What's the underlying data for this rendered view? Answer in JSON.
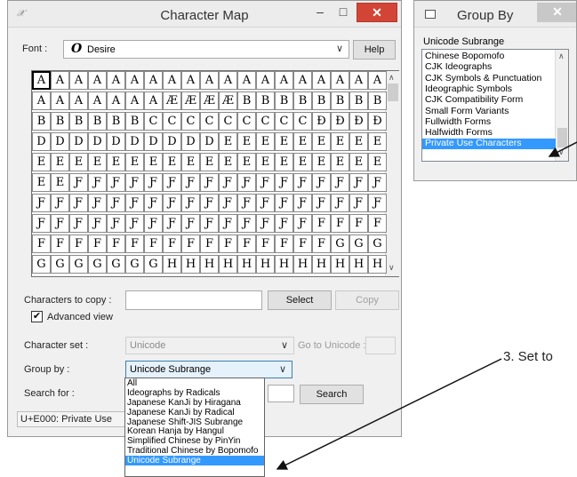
{
  "char_map": {
    "title": "Character Map",
    "font_label": "Font :",
    "font_value": "Desire",
    "font_glyph": "O",
    "help_label": "Help",
    "grid_rows": [
      [
        "A",
        "A",
        "A",
        "A",
        "A",
        "A",
        "A",
        "A",
        "A",
        "A",
        "A",
        "A",
        "A",
        "A",
        "A",
        "A",
        "A",
        "A",
        "A"
      ],
      [
        "A",
        "A",
        "A",
        "A",
        "A",
        "A",
        "A",
        "Æ",
        "Æ",
        "Æ",
        "Æ",
        "B",
        "B",
        "B",
        "B",
        "B",
        "B",
        "B",
        "B"
      ],
      [
        "B",
        "B",
        "B",
        "B",
        "B",
        "B",
        "C",
        "C",
        "C",
        "C",
        "C",
        "C",
        "C",
        "C",
        "C",
        "Ð",
        "Ð",
        "Ð",
        "Ð"
      ],
      [
        "D",
        "D",
        "D",
        "D",
        "D",
        "D",
        "D",
        "D",
        "D",
        "D",
        "E",
        "E",
        "E",
        "E",
        "E",
        "E",
        "E",
        "E",
        "E"
      ],
      [
        "E",
        "E",
        "E",
        "E",
        "E",
        "E",
        "E",
        "E",
        "E",
        "E",
        "E",
        "E",
        "E",
        "E",
        "E",
        "E",
        "E",
        "E",
        "E"
      ],
      [
        "E",
        "E",
        "Ƒ",
        "Ƒ",
        "Ƒ",
        "Ƒ",
        "Ƒ",
        "Ƒ",
        "Ƒ",
        "Ƒ",
        "Ƒ",
        "Ƒ",
        "Ƒ",
        "Ƒ",
        "Ƒ",
        "Ƒ",
        "Ƒ",
        "Ƒ",
        "Ƒ"
      ],
      [
        "Ƒ",
        "Ƒ",
        "Ƒ",
        "Ƒ",
        "Ƒ",
        "Ƒ",
        "Ƒ",
        "Ƒ",
        "Ƒ",
        "Ƒ",
        "Ƒ",
        "Ƒ",
        "Ƒ",
        "Ƒ",
        "Ƒ",
        "Ƒ",
        "Ƒ",
        "Ƒ",
        "Ƒ"
      ],
      [
        "Ƒ",
        "Ƒ",
        "Ƒ",
        "Ƒ",
        "Ƒ",
        "Ƒ",
        "Ƒ",
        "Ƒ",
        "Ƒ",
        "Ƒ",
        "Ƒ",
        "Ƒ",
        "Ƒ",
        "Ƒ",
        "Ƒ",
        "F",
        "F",
        "F",
        "F"
      ],
      [
        "F",
        "F",
        "F",
        "F",
        "F",
        "F",
        "F",
        "F",
        "F",
        "F",
        "F",
        "F",
        "F",
        "F",
        "F",
        "F",
        "G",
        "G",
        "G"
      ],
      [
        "G",
        "G",
        "G",
        "G",
        "G",
        "G",
        "G",
        "H",
        "H",
        "H",
        "H",
        "H",
        "H",
        "H",
        "H",
        "H",
        "H",
        "H",
        "H"
      ]
    ],
    "chars_to_copy_label": "Characters to copy :",
    "chars_to_copy_value": "",
    "select_label": "Select",
    "copy_label": "Copy",
    "advanced_view_label": "Advanced view",
    "advanced_view_checked": "✔",
    "character_set_label": "Character set :",
    "character_set_value": "Unicode",
    "go_to_unicode_label": "Go to Unicode :",
    "group_by_label": "Group by :",
    "group_by_value": "Unicode Subrange",
    "group_by_options": [
      "All",
      "Ideographs by Radicals",
      "Japanese KanJi by Hiragana",
      "Japanese KanJi by Radical",
      "Japanese Shift-JIS Subrange",
      "Korean Hanja by Hangul",
      "Simplified Chinese by PinYin",
      "Traditional Chinese by Bopomofo",
      "Unicode Subrange"
    ],
    "search_for_label": "Search for :",
    "search_label": "Search",
    "status_text": "U+E000: Private Use"
  },
  "group_by_window": {
    "title": "Group By",
    "heading": "Unicode Subrange",
    "items": [
      "Chinese Bopomofo",
      "CJK Ideographs",
      "CJK Symbols & Punctuation",
      "Ideographic Symbols",
      "CJK Compatibility Form",
      "Small Form Variants",
      "Fullwidth Forms",
      "Halfwidth Forms",
      "Private Use Characters"
    ]
  },
  "annotation": "3. Set to",
  "colors": {
    "selection": "#3399ff",
    "close_button": "#d24536"
  }
}
